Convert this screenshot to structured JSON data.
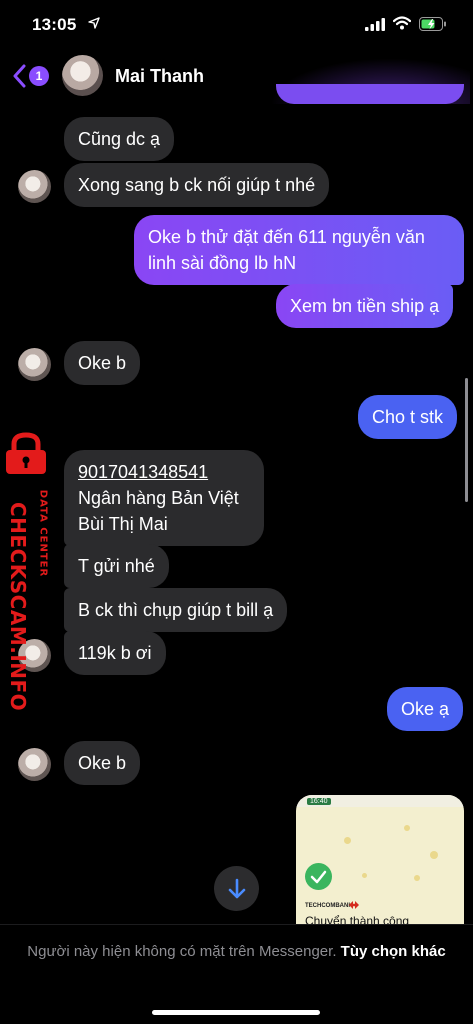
{
  "status_bar": {
    "time": "13:05"
  },
  "header": {
    "back_badge": "1",
    "name": "Mai Thanh"
  },
  "messages": {
    "m1": "Cũng dc ạ",
    "m2": "Xong sang b ck nối giúp t nhé",
    "m3_line1": "Oke b thử đặt đến 611 nguyễn văn",
    "m3_line2": "linh sài đồng lb hN",
    "m4": "Xem bn tiền ship ạ",
    "m5": "Oke b",
    "m6": "Cho t stk",
    "m7_line1": "9017041348541",
    "m7_line2": "Ngân hàng Bản Việt",
    "m7_line3": "Bùi Thị Mai",
    "m8": "T gửi nhé",
    "m9": "B ck thì chụp giúp t bill ạ",
    "m10": "119k b ơi",
    "m11": "Oke ạ",
    "m12": "Oke b"
  },
  "shared_image": {
    "time": "16:40",
    "bank": "TECHCOMBANK",
    "caption": "Chuyển thành công"
  },
  "watermark": {
    "main": "CHECKSCAM.INFO",
    "sub": "DATA CENTER"
  },
  "footer": {
    "text": "Người này hiện không có mặt trên Messenger.",
    "link": "Tùy chọn khác"
  },
  "colors": {
    "outgoing": "#7b4df0",
    "incoming": "#2b2b2d",
    "blue": "#4a62f2",
    "watermark": "#e31b1b"
  }
}
